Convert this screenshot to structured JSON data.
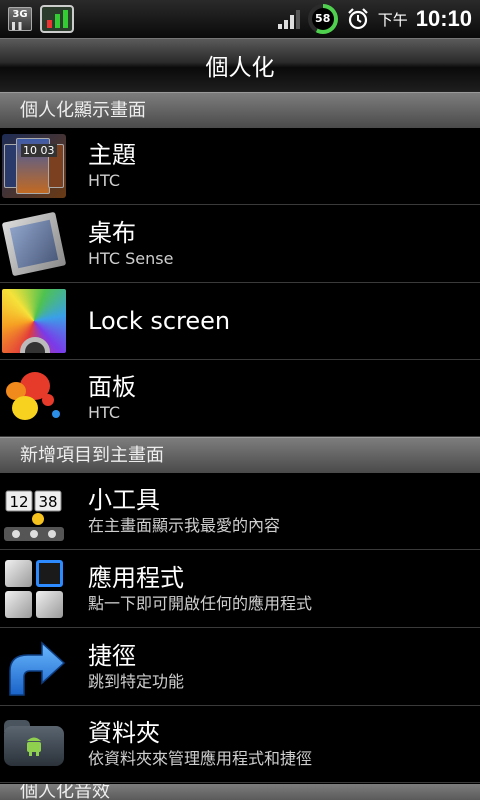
{
  "status_bar": {
    "network": "3G",
    "battery_level": "58",
    "ampm": "下午",
    "time": "10:10",
    "battery_color": "#4fd14f"
  },
  "title": "個人化",
  "sections": [
    {
      "header": "個人化顯示畫面",
      "items": [
        {
          "title": "主題",
          "subtitle": "HTC",
          "icon": "theme-icon"
        },
        {
          "title": "桌布",
          "subtitle": "HTC Sense",
          "icon": "wallpaper-icon"
        },
        {
          "title": "Lock screen",
          "subtitle": "",
          "icon": "lock-screen-icon"
        },
        {
          "title": "面板",
          "subtitle": "HTC",
          "icon": "skin-icon"
        }
      ]
    },
    {
      "header": "新增項目到主畫面",
      "items": [
        {
          "title": "小工具",
          "subtitle": "在主畫面顯示我最愛的內容",
          "icon": "widget-icon"
        },
        {
          "title": "應用程式",
          "subtitle": "點一下即可開啟任何的應用程式",
          "icon": "apps-icon"
        },
        {
          "title": "捷徑",
          "subtitle": "跳到特定功能",
          "icon": "shortcut-arrow-icon"
        },
        {
          "title": "資料夾",
          "subtitle": "依資料夾來管理應用程式和捷徑",
          "icon": "folder-icon"
        }
      ]
    },
    {
      "header": "個人化音效"
    }
  ]
}
